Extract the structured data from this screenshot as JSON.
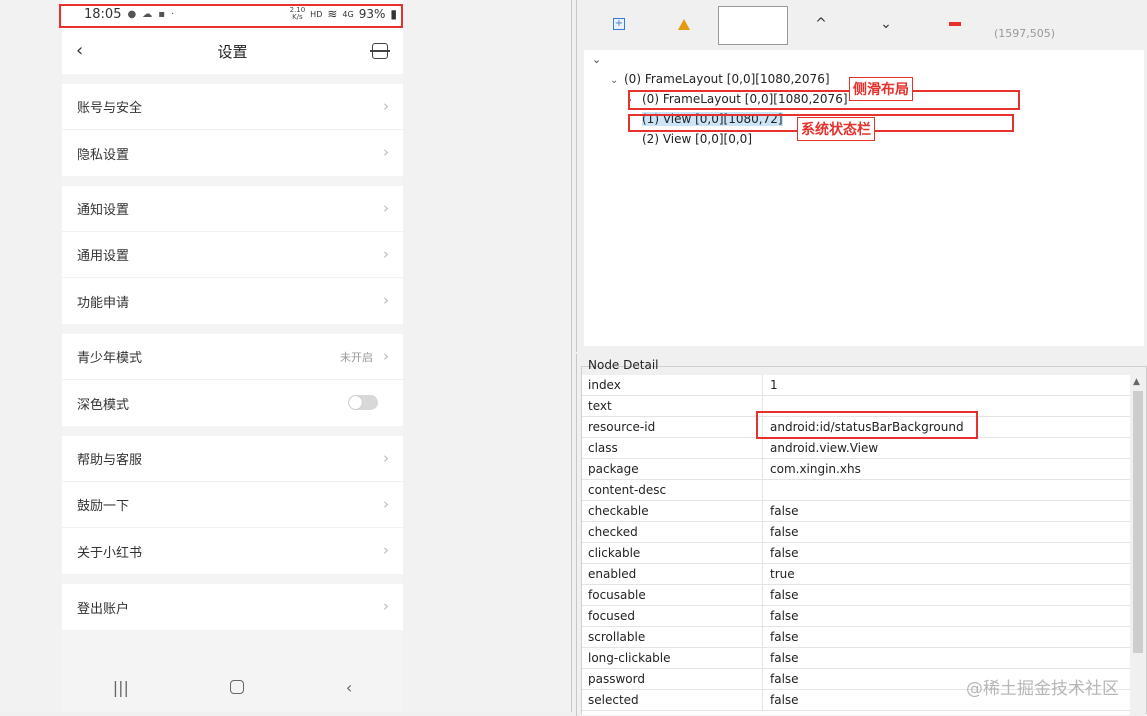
{
  "phone": {
    "status_bar": {
      "time": "18:05",
      "speed_top": "2.10",
      "speed_bottom": "K/s",
      "hd": "HD",
      "signal": "4G",
      "battery": "93%"
    },
    "top_bar": {
      "back": "‹",
      "title": "设置"
    },
    "groups": [
      [
        {
          "label": "账号与安全"
        },
        {
          "label": "隐私设置"
        }
      ],
      [
        {
          "label": "通知设置"
        },
        {
          "label": "通用设置"
        },
        {
          "label": "功能申请"
        }
      ],
      [
        {
          "label": "青少年模式",
          "extra": "未开启"
        },
        {
          "label": "深色模式"
        }
      ],
      [
        {
          "label": "帮助与客服"
        },
        {
          "label": "鼓励一下"
        },
        {
          "label": "关于小红书"
        }
      ],
      [
        {
          "label": "登出账户"
        }
      ]
    ],
    "chevron": "›",
    "nav": {
      "recent": "|||",
      "back": "‹"
    }
  },
  "toolbar": {
    "expand": "+",
    "up": "^",
    "down": "⌄",
    "coords": "(1597,505)"
  },
  "tree": {
    "root_toggle": "⌄",
    "nodes": [
      {
        "arrow": "⌄",
        "text": "(0) FrameLayout [0,0][1080,2076]"
      },
      {
        "arrow": "›",
        "text": "(0) FrameLayout [0,0][1080,2076]"
      },
      {
        "arrow": "",
        "text": "(1) View [0,0][1080,72]"
      },
      {
        "arrow": "",
        "text": "(2) View [0,0][0,0]"
      }
    ],
    "annotations": [
      "侧滑布局",
      "系统状态栏"
    ]
  },
  "node_detail": {
    "title": "Node Detail",
    "rows": [
      {
        "key": "index",
        "value": "1"
      },
      {
        "key": "text",
        "value": ""
      },
      {
        "key": "resource-id",
        "value": "android:id/statusBarBackground"
      },
      {
        "key": "class",
        "value": "android.view.View"
      },
      {
        "key": "package",
        "value": "com.xingin.xhs"
      },
      {
        "key": "content-desc",
        "value": ""
      },
      {
        "key": "checkable",
        "value": "false"
      },
      {
        "key": "checked",
        "value": "false"
      },
      {
        "key": "clickable",
        "value": "false"
      },
      {
        "key": "enabled",
        "value": "true"
      },
      {
        "key": "focusable",
        "value": "false"
      },
      {
        "key": "focused",
        "value": "false"
      },
      {
        "key": "scrollable",
        "value": "false"
      },
      {
        "key": "long-clickable",
        "value": "false"
      },
      {
        "key": "password",
        "value": "false"
      },
      {
        "key": "selected",
        "value": "false"
      }
    ]
  },
  "watermark": "@稀土掘金技术社区",
  "colors": {
    "annotation_red": "#e5322d",
    "selection": "#cce4f7"
  }
}
